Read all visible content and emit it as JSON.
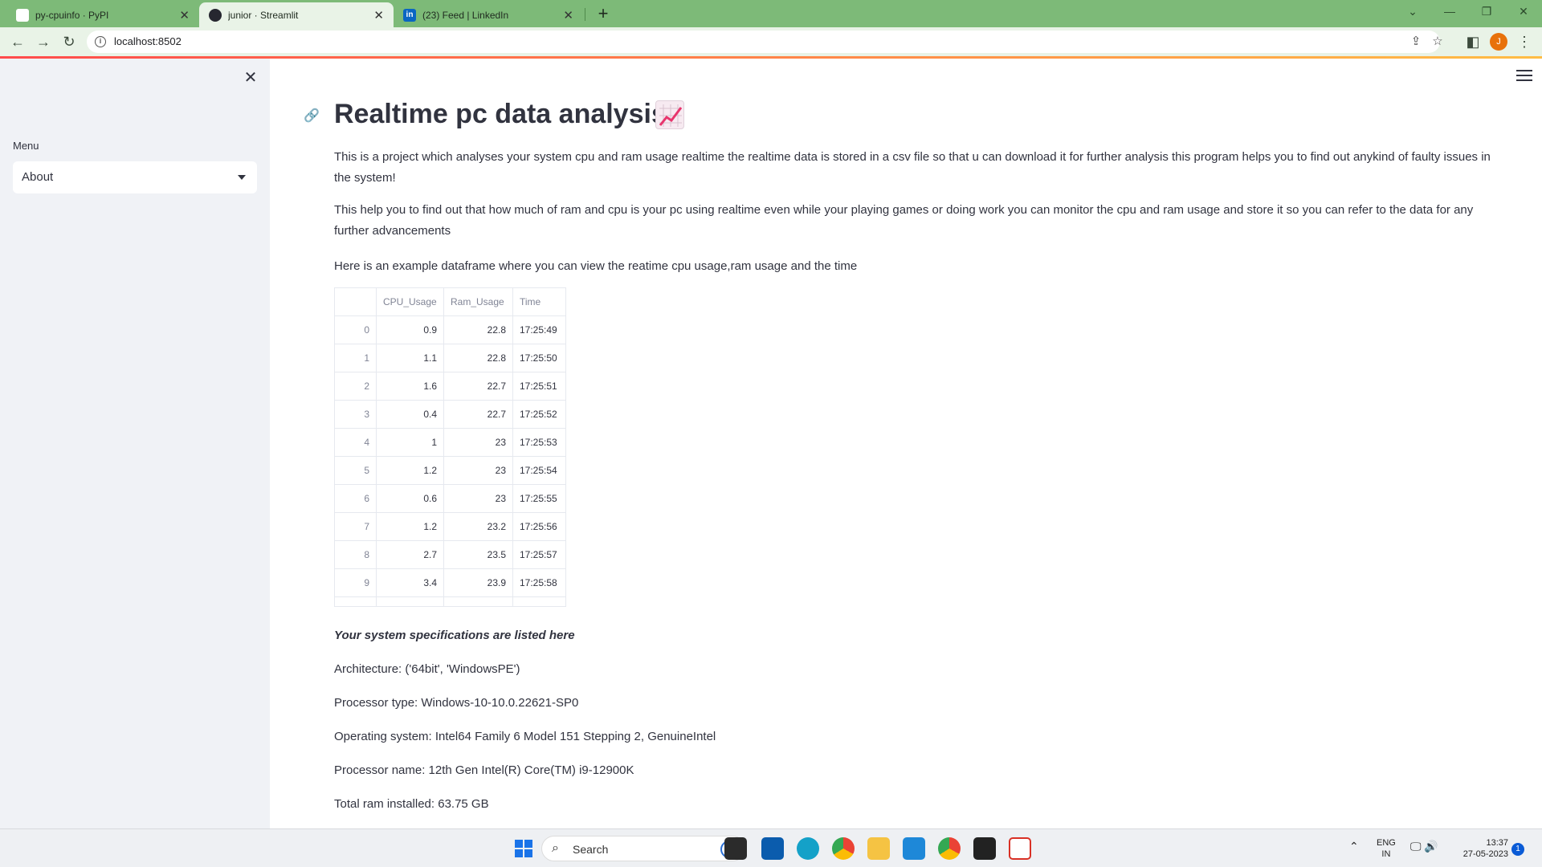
{
  "browser": {
    "tabs": [
      {
        "title": "py-cpuinfo · PyPI",
        "active": false
      },
      {
        "title": "junior · Streamlit",
        "active": true
      },
      {
        "title": "(23) Feed | LinkedIn",
        "active": false
      }
    ],
    "url": "localhost:8502",
    "profile_initial": "J"
  },
  "sidebar": {
    "menu_label": "Menu",
    "selected": "About"
  },
  "main": {
    "title": "Realtime pc data analysis",
    "para1": "This is a project which analyses your system cpu and ram usage realtime the realtime data is stored in a csv file so that u can download it for further analysis this program helps you to find out anykind of faulty issues in the system!",
    "para2": "This help you to find out that how much of ram and cpu is your pc using realtime even while your playing games or doing work you can monitor the cpu and ram usage and store it so you can refer to the data for any further advancements",
    "para3": "Here is an example dataframe where you can view the reatime cpu usage,ram usage and the time",
    "table": {
      "columns": [
        "",
        "CPU_Usage",
        "Ram_Usage",
        "Time"
      ],
      "rows": [
        [
          "0",
          "0.9",
          "22.8",
          "17:25:49"
        ],
        [
          "1",
          "1.1",
          "22.8",
          "17:25:50"
        ],
        [
          "2",
          "1.6",
          "22.7",
          "17:25:51"
        ],
        [
          "3",
          "0.4",
          "22.7",
          "17:25:52"
        ],
        [
          "4",
          "1",
          "23",
          "17:25:53"
        ],
        [
          "5",
          "1.2",
          "23",
          "17:25:54"
        ],
        [
          "6",
          "0.6",
          "23",
          "17:25:55"
        ],
        [
          "7",
          "1.2",
          "23.2",
          "17:25:56"
        ],
        [
          "8",
          "2.7",
          "23.5",
          "17:25:57"
        ],
        [
          "9",
          "3.4",
          "23.9",
          "17:25:58"
        ]
      ]
    },
    "specs_heading": "Your system specifications are listed here",
    "architecture": "Architecture: ('64bit', 'WindowsPE')",
    "processor_type": "Processor type: Windows-10-10.0.22621-SP0",
    "os": "Operating system: Intel64 Family 6 Model 151 Stepping 2, GenuineIntel",
    "processor_name": "Processor name: 12th Gen Intel(R) Core(TM) i9-12900K",
    "ram": "Total ram installed: 63.75 GB"
  },
  "taskbar": {
    "search_placeholder": "Search",
    "lang_1": "ENG",
    "lang_2": "IN",
    "time": "13:37",
    "date": "27-05-2023",
    "notifications": "1"
  },
  "colors": {
    "tabbar": "#7dba78",
    "accent": "#ff4b4b",
    "sidebar_bg": "#f0f2f6"
  }
}
